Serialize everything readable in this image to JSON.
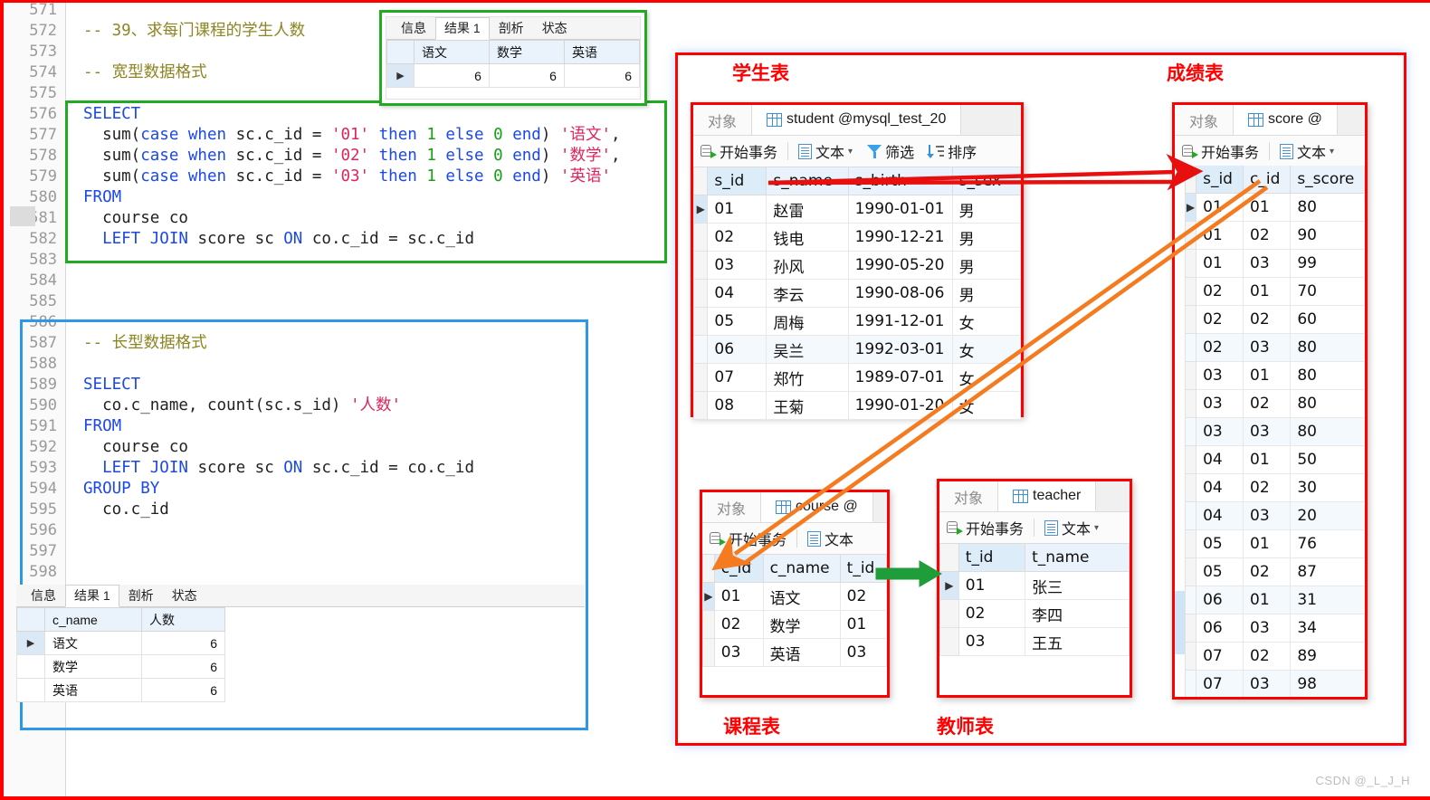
{
  "editor": {
    "line_start": 571,
    "lines": [
      {
        "n": 571,
        "segs": []
      },
      {
        "n": 572,
        "segs": [
          {
            "t": "-- 39、求每门课程的学生人数",
            "c": "cmt"
          }
        ]
      },
      {
        "n": 573,
        "segs": []
      },
      {
        "n": 574,
        "segs": [
          {
            "t": "-- 宽型数据格式",
            "c": "cmt"
          }
        ]
      },
      {
        "n": 575,
        "segs": []
      },
      {
        "n": 576,
        "segs": [
          {
            "t": "SELECT",
            "c": "kw"
          }
        ]
      },
      {
        "n": 577,
        "segs": [
          {
            "t": "  sum(",
            "c": "pl"
          },
          {
            "t": "case when",
            "c": "kw"
          },
          {
            "t": " sc.c_id = ",
            "c": "pl"
          },
          {
            "t": "'01'",
            "c": "str"
          },
          {
            "t": " then",
            "c": "kw"
          },
          {
            "t": " ",
            "c": "pl"
          },
          {
            "t": "1",
            "c": "num"
          },
          {
            "t": " else",
            "c": "kw"
          },
          {
            "t": " ",
            "c": "pl"
          },
          {
            "t": "0",
            "c": "num"
          },
          {
            "t": " end",
            "c": "kw"
          },
          {
            "t": ") ",
            "c": "pl"
          },
          {
            "t": "'语文'",
            "c": "str"
          },
          {
            "t": ",",
            "c": "pl"
          }
        ]
      },
      {
        "n": 578,
        "segs": [
          {
            "t": "  sum(",
            "c": "pl"
          },
          {
            "t": "case when",
            "c": "kw"
          },
          {
            "t": " sc.c_id = ",
            "c": "pl"
          },
          {
            "t": "'02'",
            "c": "str"
          },
          {
            "t": " then",
            "c": "kw"
          },
          {
            "t": " ",
            "c": "pl"
          },
          {
            "t": "1",
            "c": "num"
          },
          {
            "t": " else",
            "c": "kw"
          },
          {
            "t": " ",
            "c": "pl"
          },
          {
            "t": "0",
            "c": "num"
          },
          {
            "t": " end",
            "c": "kw"
          },
          {
            "t": ") ",
            "c": "pl"
          },
          {
            "t": "'数学'",
            "c": "str"
          },
          {
            "t": ",",
            "c": "pl"
          }
        ]
      },
      {
        "n": 579,
        "segs": [
          {
            "t": "  sum(",
            "c": "pl"
          },
          {
            "t": "case when",
            "c": "kw"
          },
          {
            "t": " sc.c_id = ",
            "c": "pl"
          },
          {
            "t": "'03'",
            "c": "str"
          },
          {
            "t": " then",
            "c": "kw"
          },
          {
            "t": " ",
            "c": "pl"
          },
          {
            "t": "1",
            "c": "num"
          },
          {
            "t": " else",
            "c": "kw"
          },
          {
            "t": " ",
            "c": "pl"
          },
          {
            "t": "0",
            "c": "num"
          },
          {
            "t": " end",
            "c": "kw"
          },
          {
            "t": ") ",
            "c": "pl"
          },
          {
            "t": "'英语'",
            "c": "str"
          }
        ]
      },
      {
        "n": 580,
        "segs": [
          {
            "t": "FROM",
            "c": "kw"
          }
        ]
      },
      {
        "n": 581,
        "segs": [
          {
            "t": "  course co",
            "c": "pl"
          }
        ]
      },
      {
        "n": 582,
        "segs": [
          {
            "t": "  ",
            "c": "pl"
          },
          {
            "t": "LEFT JOIN",
            "c": "kw"
          },
          {
            "t": " score sc ",
            "c": "pl"
          },
          {
            "t": "ON",
            "c": "kw"
          },
          {
            "t": " co.c_id = sc.c_id",
            "c": "pl"
          }
        ]
      },
      {
        "n": 583,
        "segs": []
      },
      {
        "n": 584,
        "segs": []
      },
      {
        "n": 585,
        "segs": []
      },
      {
        "n": 586,
        "segs": []
      },
      {
        "n": 587,
        "segs": [
          {
            "t": "-- 长型数据格式",
            "c": "cmt"
          }
        ]
      },
      {
        "n": 588,
        "segs": []
      },
      {
        "n": 589,
        "segs": [
          {
            "t": "SELECT",
            "c": "kw"
          }
        ]
      },
      {
        "n": 590,
        "segs": [
          {
            "t": "  co.c_name, count(sc.s_id) ",
            "c": "pl"
          },
          {
            "t": "'人数'",
            "c": "str"
          }
        ]
      },
      {
        "n": 591,
        "segs": [
          {
            "t": "FROM",
            "c": "kw"
          }
        ]
      },
      {
        "n": 592,
        "segs": [
          {
            "t": "  course co",
            "c": "pl"
          }
        ]
      },
      {
        "n": 593,
        "segs": [
          {
            "t": "  ",
            "c": "pl"
          },
          {
            "t": "LEFT JOIN",
            "c": "kw"
          },
          {
            "t": " score sc ",
            "c": "pl"
          },
          {
            "t": "ON",
            "c": "kw"
          },
          {
            "t": " sc.c_id = co.c_id",
            "c": "pl"
          }
        ]
      },
      {
        "n": 594,
        "segs": [
          {
            "t": "GROUP BY",
            "c": "kw"
          }
        ]
      },
      {
        "n": 595,
        "segs": [
          {
            "t": "  co.c_id",
            "c": "pl"
          }
        ]
      },
      {
        "n": 596,
        "segs": []
      },
      {
        "n": 597,
        "segs": []
      },
      {
        "n": 598,
        "segs": []
      }
    ]
  },
  "result_top": {
    "tabs": [
      "信息",
      "结果 1",
      "剖析",
      "状态"
    ],
    "selected_tab": "结果 1",
    "columns": [
      "语文",
      "数学",
      "英语"
    ],
    "rows": [
      [
        "6",
        "6",
        "6"
      ]
    ]
  },
  "result_bottom": {
    "tabs": [
      "信息",
      "结果 1",
      "剖析",
      "状态"
    ],
    "selected_tab": "结果 1",
    "columns": [
      "c_name",
      "人数"
    ],
    "rows": [
      [
        "语文",
        "6"
      ],
      [
        "数学",
        "6"
      ],
      [
        "英语",
        "6"
      ]
    ]
  },
  "diagram": {
    "captions": {
      "student": "学生表",
      "score": "成绩表",
      "course": "课程表",
      "teacher": "教师表"
    },
    "toolbar": {
      "object_tab": "对象",
      "begin_transaction": "开始事务",
      "text": "文本",
      "filter": "筛选",
      "sort": "排序"
    },
    "student": {
      "title": "student @mysql_test_20",
      "columns": [
        "s_id",
        "s_name",
        "s_birth",
        "s_sex"
      ],
      "rows": [
        [
          "01",
          "赵雷",
          "1990-01-01",
          "男"
        ],
        [
          "02",
          "钱电",
          "1990-12-21",
          "男"
        ],
        [
          "03",
          "孙风",
          "1990-05-20",
          "男"
        ],
        [
          "04",
          "李云",
          "1990-08-06",
          "男"
        ],
        [
          "05",
          "周梅",
          "1991-12-01",
          "女"
        ],
        [
          "06",
          "吴兰",
          "1992-03-01",
          "女"
        ],
        [
          "07",
          "郑竹",
          "1989-07-01",
          "女"
        ],
        [
          "08",
          "王菊",
          "1990-01-20",
          "女"
        ]
      ]
    },
    "score": {
      "title": "score @",
      "columns": [
        "s_id",
        "c_id",
        "s_score"
      ],
      "rows": [
        [
          "01",
          "01",
          "80"
        ],
        [
          "01",
          "02",
          "90"
        ],
        [
          "01",
          "03",
          "99"
        ],
        [
          "02",
          "01",
          "70"
        ],
        [
          "02",
          "02",
          "60"
        ],
        [
          "02",
          "03",
          "80"
        ],
        [
          "03",
          "01",
          "80"
        ],
        [
          "03",
          "02",
          "80"
        ],
        [
          "03",
          "03",
          "80"
        ],
        [
          "04",
          "01",
          "50"
        ],
        [
          "04",
          "02",
          "30"
        ],
        [
          "04",
          "03",
          "20"
        ],
        [
          "05",
          "01",
          "76"
        ],
        [
          "05",
          "02",
          "87"
        ],
        [
          "06",
          "01",
          "31"
        ],
        [
          "06",
          "03",
          "34"
        ],
        [
          "07",
          "02",
          "89"
        ],
        [
          "07",
          "03",
          "98"
        ]
      ]
    },
    "course": {
      "title": "course @",
      "columns": [
        "c_id",
        "c_name",
        "t_id"
      ],
      "rows": [
        [
          "01",
          "语文",
          "02"
        ],
        [
          "02",
          "数学",
          "01"
        ],
        [
          "03",
          "英语",
          "03"
        ]
      ]
    },
    "teacher": {
      "title": "teacher",
      "columns": [
        "t_id",
        "t_name"
      ],
      "rows": [
        [
          "01",
          "张三"
        ],
        [
          "02",
          "李四"
        ],
        [
          "03",
          "王五"
        ]
      ]
    },
    "arrows": [
      {
        "name": "student-sid-to-score-sid",
        "color": "#e8100f"
      },
      {
        "name": "score-cid-to-course-cid",
        "color": "#f47b20"
      },
      {
        "name": "course-tid-to-teacher-tid",
        "color": "#1f9d3a"
      }
    ]
  },
  "watermark": "CSDN @_L_J_H",
  "colors": {
    "keyword": "#1b48e8",
    "comment": "#8d8522",
    "string": "#e0245e",
    "number": "#15a015",
    "frame_red": "#ff0000",
    "green_box": "#22aa22",
    "blue_box": "#2f97e8",
    "arrow_red": "#e8100f",
    "arrow_orange": "#f47b20",
    "arrow_green": "#1f9d3a"
  }
}
